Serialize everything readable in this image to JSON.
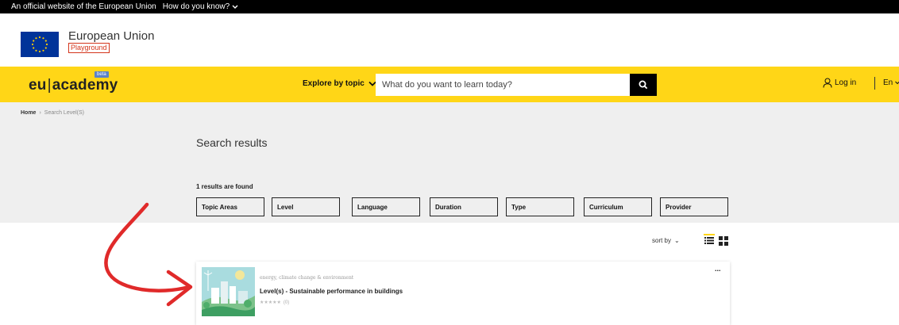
{
  "topbar": {
    "official_text": "An official website of the European Union",
    "how_text": "How do you know?"
  },
  "eu_header": {
    "name": "European Union",
    "badge": "Playground"
  },
  "nav": {
    "logo_left": "eu",
    "logo_sep": "|",
    "logo_right": "academy",
    "beta": "beta",
    "explore_label": "Explore by topic",
    "search_placeholder": "What do you want to learn today?",
    "login_label": "Log in",
    "language": "En"
  },
  "breadcrumb": {
    "home": "Home",
    "current": "Search Level(S)"
  },
  "results": {
    "title": "Search results",
    "count_text": "1 results are found",
    "filters": [
      "Topic Areas",
      "Level",
      "Language",
      "Duration",
      "Type",
      "Curriculum",
      "Provider"
    ]
  },
  "sort": {
    "label": "sort by"
  },
  "card": {
    "topic": "energy, climate change & environment",
    "title": "Level(s) - Sustainable performance in buildings",
    "stars": "★★★★★",
    "rating_count": "(0)",
    "more": "..."
  },
  "colors": {
    "brand_yellow": "#ffd617",
    "eu_blue": "#003399",
    "annotation_red": "#e02a2a",
    "page_grey": "#efefef"
  }
}
